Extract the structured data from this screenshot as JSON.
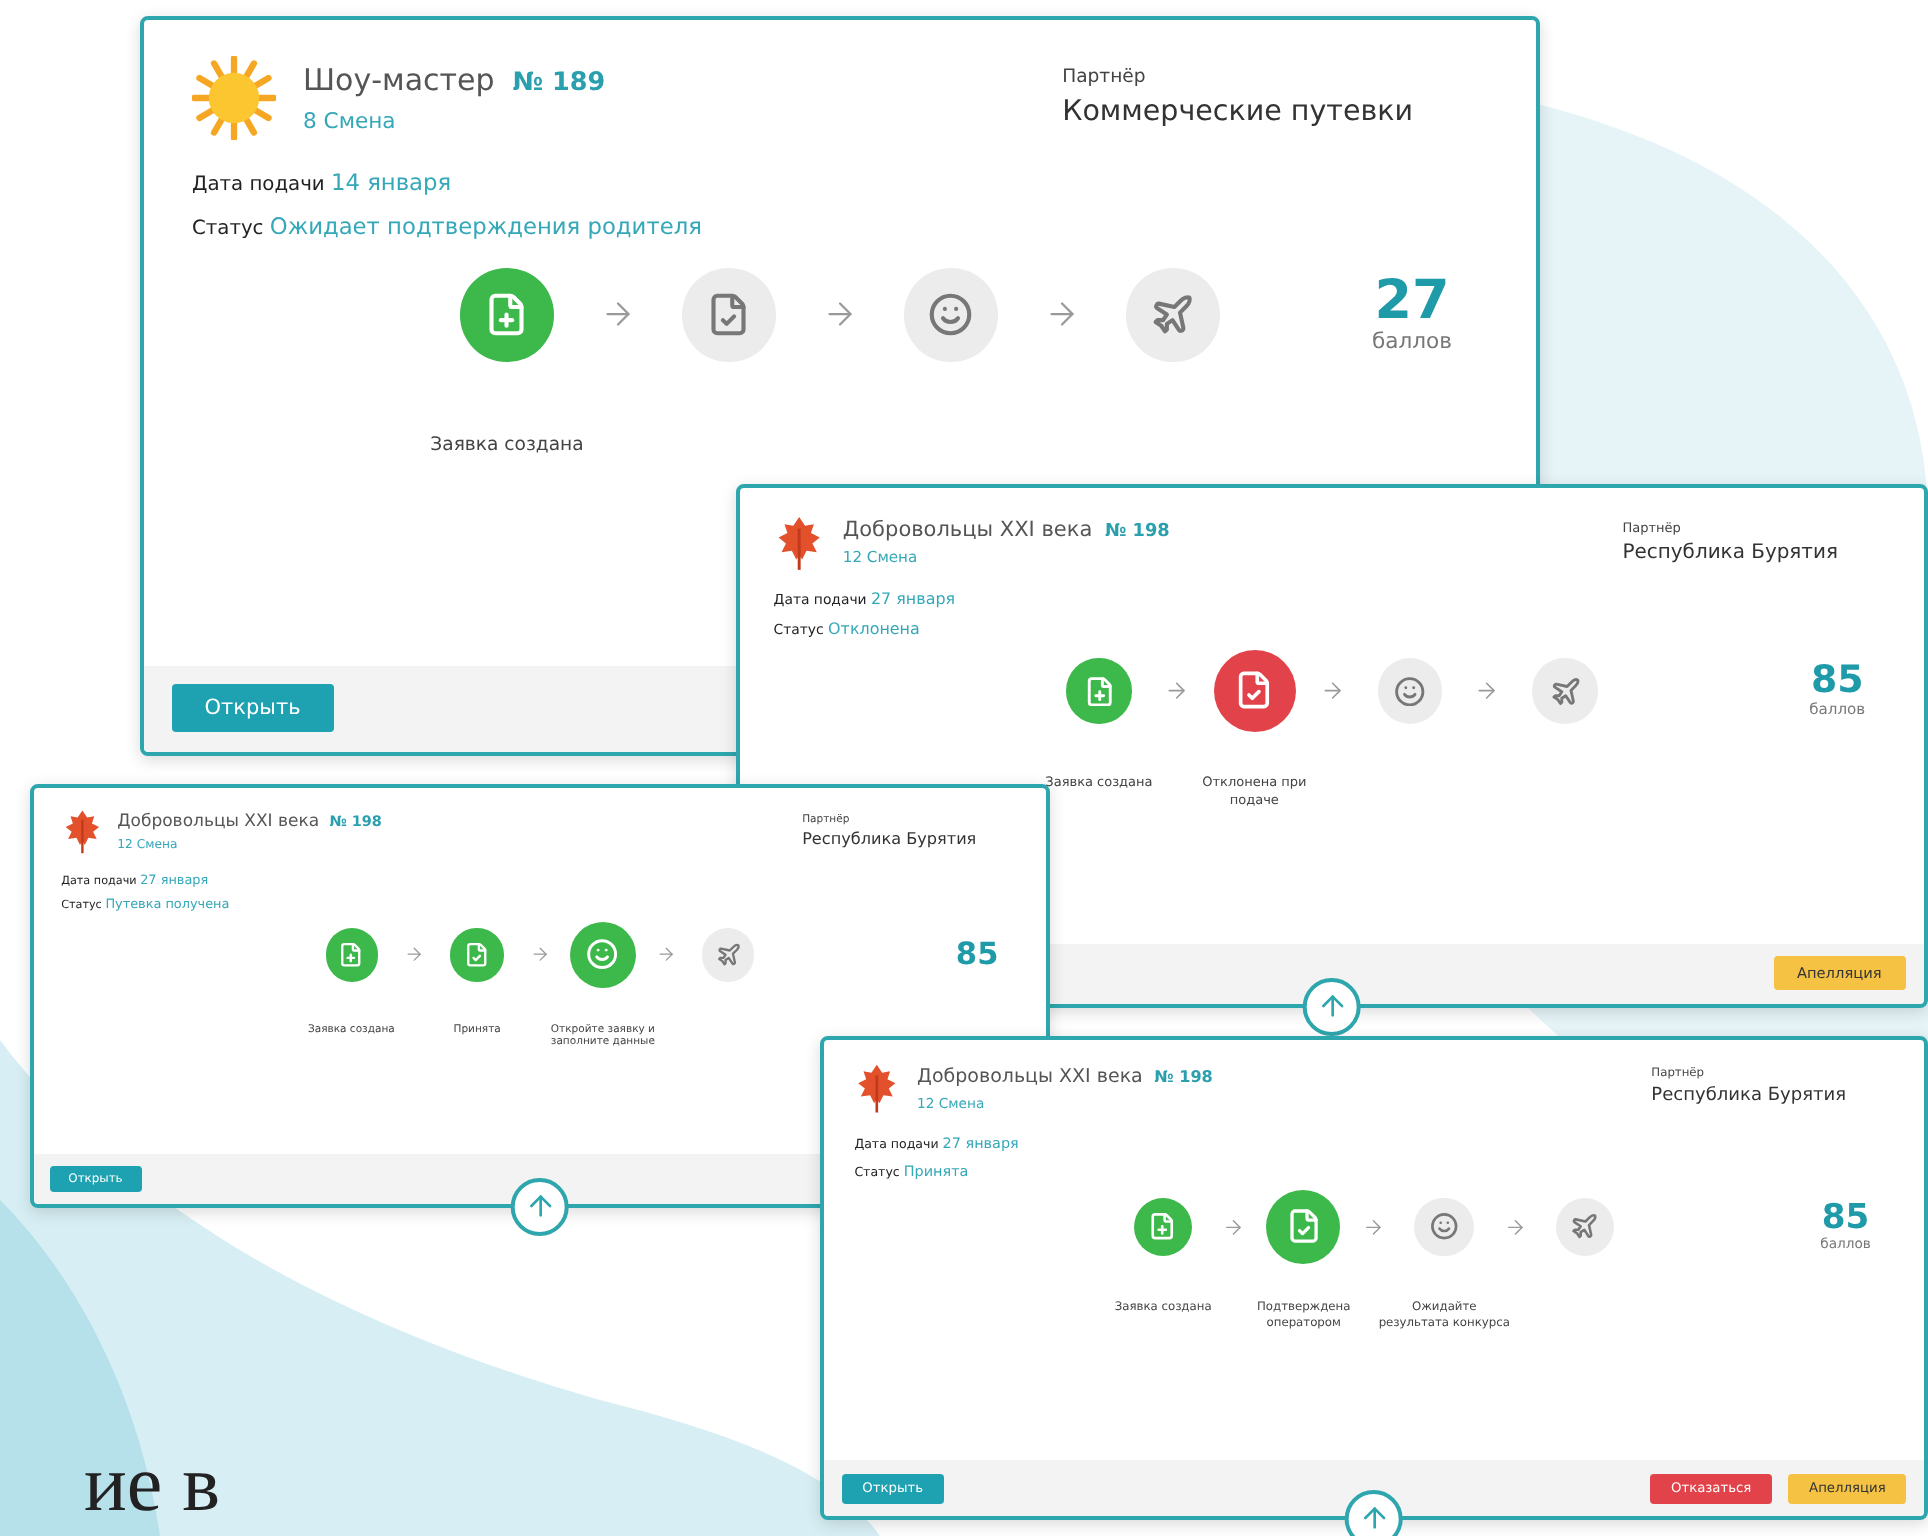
{
  "cards": [
    {
      "kind": "sun",
      "title": "Шоу-мастер",
      "number": "№ 189",
      "shift": "8 Смена",
      "partner_label": "Партнёр",
      "partner": "Коммерческие путевки",
      "date_label": "Дата подачи",
      "date": "14 января",
      "status_label": "Статус",
      "status": "Ожидает подтверждения родителя",
      "score": "27",
      "score_label": "баллов",
      "steps": [
        {
          "kind": "done",
          "label": "Заявка создана"
        },
        {
          "kind": "pending"
        },
        {
          "kind": "pending"
        },
        {
          "kind": "pending"
        }
      ],
      "buttons": [
        {
          "kind": "open",
          "label": "Открыть"
        }
      ]
    },
    {
      "kind": "leaf",
      "title": "Добровольцы XXI века",
      "number": "№ 198",
      "shift": "12 Смена",
      "partner_label": "Партнёр",
      "partner": "Республика Бурятия",
      "date_label": "Дата подачи",
      "date": "27 января",
      "status_label": "Статус",
      "status": "Отклонена",
      "score": "85",
      "score_label": "баллов",
      "steps": [
        {
          "kind": "done",
          "label": "Заявка создана"
        },
        {
          "kind": "rejected",
          "label": "Отклонена при подаче"
        },
        {
          "kind": "pending"
        },
        {
          "kind": "pending"
        }
      ],
      "buttons": [
        {
          "kind": "appeal",
          "label": "Апелляция"
        }
      ]
    },
    {
      "kind": "leaf",
      "title": "Добровольцы XXI века",
      "number": "№ 198",
      "shift": "12 Смена",
      "partner_label": "Партнёр",
      "partner": "Республика Бурятия",
      "date_label": "Дата подачи",
      "date": "27 января",
      "status_label": "Статус",
      "status": "Путевка получена",
      "score": "85",
      "steps": [
        {
          "kind": "done",
          "label": "Заявка создана"
        },
        {
          "kind": "done",
          "label": "Принята"
        },
        {
          "kind": "active",
          "label": "Откройте заявку и заполните данные"
        },
        {
          "kind": "pending"
        }
      ],
      "buttons": [
        {
          "kind": "open",
          "label": "Открыть"
        }
      ]
    },
    {
      "kind": "leaf",
      "title": "Добровольцы XXI века",
      "number": "№ 198",
      "shift": "12 Смена",
      "partner_label": "Партнёр",
      "partner": "Республика Бурятия",
      "date_label": "Дата подачи",
      "date": "27 января",
      "status_label": "Статус",
      "status": "Принята",
      "score": "85",
      "score_label": "баллов",
      "steps": [
        {
          "kind": "done",
          "label": "Заявка создана"
        },
        {
          "kind": "active",
          "label": "Подтверждена оператором"
        },
        {
          "kind": "pending",
          "label": "Ожидайте результата конкурса"
        },
        {
          "kind": "pending"
        }
      ],
      "buttons": [
        {
          "kind": "open",
          "label": "Открыть"
        },
        {
          "kind": "refuse",
          "label": "Отказаться"
        },
        {
          "kind": "appeal",
          "label": "Апелляция"
        }
      ]
    }
  ],
  "slide_text": "ие в"
}
